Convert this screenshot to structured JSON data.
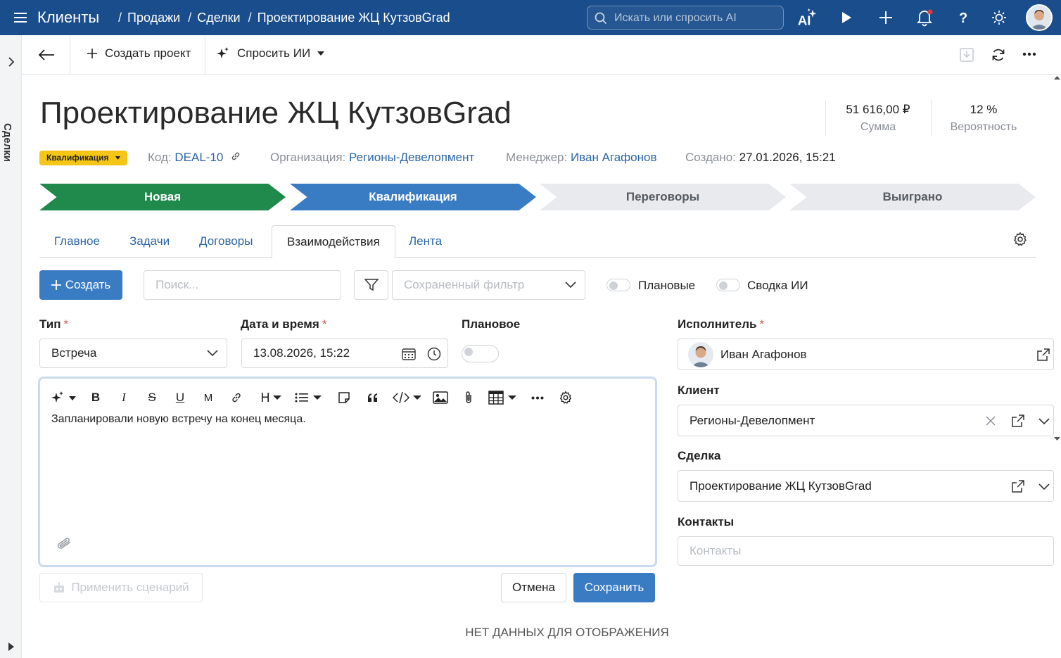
{
  "topbar": {
    "app_title": "Клиенты",
    "breadcrumbs": [
      "Продажи",
      "Сделки",
      "Проектирование ЖЦ КутзовGrad"
    ],
    "search_placeholder": "Искать или спросить AI",
    "icons": [
      "ai-sparkle-icon",
      "play-icon",
      "plus-icon",
      "bell-icon",
      "help-icon",
      "sun-icon"
    ],
    "notification_dot_color": "#e53935",
    "bg_color": "#1a4d8c"
  },
  "rail": {
    "label": "Сделки"
  },
  "toolbar": {
    "create_project_label": "Создать проект",
    "ask_ai_label": "Спросить ИИ"
  },
  "deal": {
    "title": "Проектирование ЖЦ КутзовGrad",
    "kpis": [
      {
        "value": "51 616,00 ₽",
        "label": "Сумма"
      },
      {
        "value": "12 %",
        "label": "Вероятность"
      }
    ],
    "status_badge": "Квалификация",
    "meta": {
      "code_key": "Код:",
      "code_value": "DEAL-10",
      "org_key": "Организация:",
      "org_value": "Регионы-Девелопмент",
      "manager_key": "Менеджер:",
      "manager_value": "Иван Агафонов",
      "created_key": "Создано:",
      "created_value": "27.01.2026, 15:21"
    }
  },
  "stages": [
    {
      "label": "Новая",
      "bg": "#1f8a4c",
      "fg": "#ffffff"
    },
    {
      "label": "Квалификация",
      "bg": "#3a7cc4",
      "fg": "#ffffff"
    },
    {
      "label": "Переговоры",
      "bg": "#e8eaed",
      "fg": "#555b62"
    },
    {
      "label": "Выиграно",
      "bg": "#e8eaed",
      "fg": "#555b62"
    }
  ],
  "tabs": [
    {
      "label": "Главное",
      "active": false
    },
    {
      "label": "Задачи",
      "active": false
    },
    {
      "label": "Договоры",
      "active": false
    },
    {
      "label": "Взаимодействия",
      "active": true
    },
    {
      "label": "Лента",
      "active": false
    }
  ],
  "filters": {
    "create_label": "Создать",
    "search_placeholder": "Поиск...",
    "saved_filter_placeholder": "Сохраненный фильтр",
    "planned_toggle_label": "Плановые",
    "ai_summary_toggle_label": "Сводка ИИ"
  },
  "form": {
    "type_label": "Тип",
    "type_value": "Встреча",
    "datetime_label": "Дата и время",
    "datetime_value": "13.08.2026, 15:22",
    "planned_label": "Плановое",
    "executor_label": "Исполнитель",
    "executor_value": "Иван Агафонов",
    "client_label": "Клиент",
    "client_value": "Регионы-Девелопмент",
    "deal_label": "Сделка",
    "deal_value": "Проектирование ЖЦ КутзовGrad",
    "contacts_label": "Контакты",
    "contacts_placeholder": "Контакты",
    "required_mark": "*"
  },
  "editor": {
    "text": "Запланировали новую встречу на конец месяца.",
    "tools": [
      "ai-sparkle-icon",
      "bold-icon",
      "italic-icon",
      "strikethrough-icon",
      "underline-icon",
      "mark-icon",
      "link-icon",
      "heading-icon",
      "list-icon",
      "note-icon",
      "quote-icon",
      "code-icon",
      "image-icon",
      "attachment-icon",
      "table-icon",
      "more-icon",
      "settings-icon"
    ]
  },
  "actions": {
    "apply_scenario_label": "Применить сценарий",
    "cancel_label": "Отмена",
    "save_label": "Сохранить"
  },
  "empty_state": "НЕТ ДАННЫХ ДЛЯ ОТОБРАЖЕНИЯ"
}
